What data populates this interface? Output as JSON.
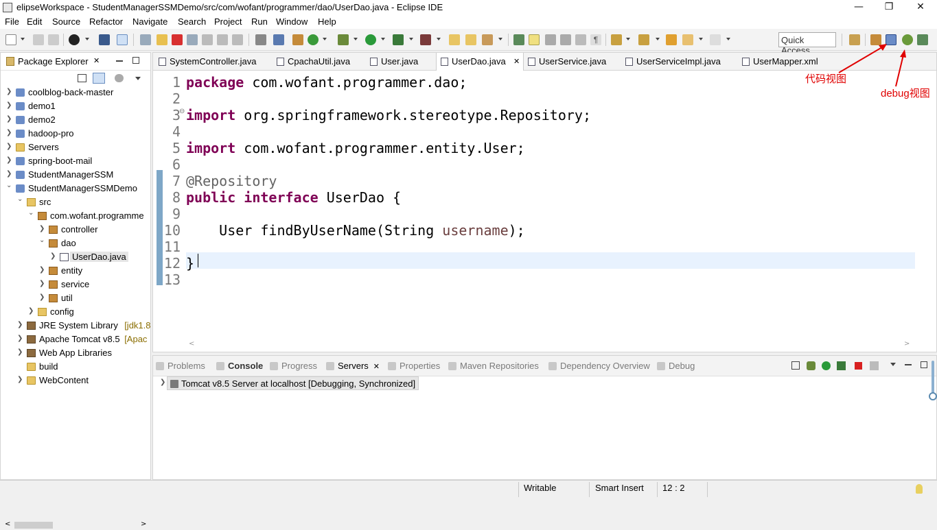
{
  "window": {
    "title": "elipseWorkspace - StudentManagerSSMDemo/src/com/wofant/programmer/dao/UserDao.java - Eclipse IDE",
    "minimize_glyph": "—",
    "maximize_glyph": "❐",
    "close_glyph": "✕"
  },
  "menu": [
    "File",
    "Edit",
    "Source",
    "Refactor",
    "Navigate",
    "Search",
    "Project",
    "Run",
    "Window",
    "Help"
  ],
  "toolbar": {
    "quick_access": "Quick Access"
  },
  "package_explorer": {
    "title": "Package Explorer",
    "close_glyph": "✕",
    "tree": [
      {
        "label": "coolblog-back-master",
        "level": 0,
        "expanded": false,
        "icon": "project-icon"
      },
      {
        "label": "demo1",
        "level": 0,
        "expanded": false,
        "icon": "project-icon"
      },
      {
        "label": "demo2",
        "level": 0,
        "expanded": false,
        "icon": "project-icon"
      },
      {
        "label": "hadoop-pro",
        "level": 0,
        "expanded": false,
        "icon": "project-icon"
      },
      {
        "label": "Servers",
        "level": 0,
        "expanded": false,
        "icon": "folder-icon"
      },
      {
        "label": "spring-boot-mail",
        "level": 0,
        "expanded": false,
        "icon": "project-icon"
      },
      {
        "label": "StudentManagerSSM",
        "level": 0,
        "expanded": false,
        "icon": "project-icon"
      },
      {
        "label": "StudentManagerSSMDemo",
        "level": 0,
        "expanded": true,
        "icon": "project-icon"
      },
      {
        "label": "src",
        "level": 1,
        "expanded": true,
        "icon": "source-folder-icon"
      },
      {
        "label": "com.wofant.programme",
        "level": 2,
        "expanded": true,
        "icon": "package-icon"
      },
      {
        "label": "controller",
        "level": 3,
        "expanded": false,
        "icon": "package-icon"
      },
      {
        "label": "dao",
        "level": 3,
        "expanded": true,
        "icon": "package-icon"
      },
      {
        "label": "UserDao.java",
        "level": 4,
        "expanded": false,
        "icon": "java-interface-icon",
        "selected": true
      },
      {
        "label": "entity",
        "level": 3,
        "expanded": false,
        "icon": "package-icon"
      },
      {
        "label": "service",
        "level": 3,
        "expanded": false,
        "icon": "package-icon"
      },
      {
        "label": "util",
        "level": 3,
        "expanded": false,
        "icon": "package-icon"
      },
      {
        "label": "config",
        "level": 2,
        "expanded": false,
        "icon": "source-folder-icon"
      },
      {
        "label": "JRE System Library",
        "decoration": " [jdk1.8.",
        "level": 1,
        "expanded": false,
        "icon": "library-icon"
      },
      {
        "label": "Apache Tomcat v8.5",
        "decoration": " [Apac",
        "level": 1,
        "expanded": false,
        "icon": "library-icon"
      },
      {
        "label": "Web App Libraries",
        "level": 1,
        "expanded": false,
        "icon": "library-icon"
      },
      {
        "label": "build",
        "level": 1,
        "expanded": null,
        "icon": "folder-icon"
      },
      {
        "label": "WebContent",
        "level": 1,
        "expanded": false,
        "icon": "folder-icon"
      }
    ]
  },
  "editor": {
    "tabs": [
      {
        "label": "SystemController.java",
        "active": false
      },
      {
        "label": "CpachaUtil.java",
        "active": false
      },
      {
        "label": "User.java",
        "active": false
      },
      {
        "label": "UserDao.java",
        "active": true
      },
      {
        "label": "UserService.java",
        "active": false
      },
      {
        "label": "UserServiceImpl.java",
        "active": false
      },
      {
        "label": "UserMapper.xml",
        "active": false
      }
    ],
    "close_glyph": "✕",
    "line_numbers": [
      "1",
      "2",
      "3",
      "4",
      "5",
      "6",
      "7",
      "8",
      "9",
      "10",
      "11",
      "12",
      "13"
    ],
    "fold_marker": "⊖",
    "lines": [
      {
        "kw": "package",
        "rest": " com.wofant.programmer.dao;"
      },
      {
        "kw": "",
        "rest": ""
      },
      {
        "kw": "import",
        "rest": " org.springframework.stereotype.Repository;"
      },
      {
        "kw": "",
        "rest": ""
      },
      {
        "kw": "import",
        "rest": " com.wofant.programmer.entity.User;"
      },
      {
        "kw": "",
        "rest": ""
      },
      {
        "annotation": "@Repository"
      },
      {
        "kw": "public",
        "kw2": "interface",
        "rest": " UserDao {"
      },
      {
        "kw": "",
        "rest": ""
      },
      {
        "indent": "    ",
        "rest": "User findByUserName(String ",
        "param": "username",
        "tail": ");"
      },
      {
        "kw": "",
        "rest": ""
      },
      {
        "kw": "",
        "rest": "}"
      },
      {
        "kw": "",
        "rest": ""
      }
    ]
  },
  "bottom_panel": {
    "tabs": [
      {
        "label": "Problems",
        "state": "inactive"
      },
      {
        "label": "Console",
        "state": "bold"
      },
      {
        "label": "Progress",
        "state": "inactive"
      },
      {
        "label": "Servers",
        "state": "active"
      },
      {
        "label": "Properties",
        "state": "inactive"
      },
      {
        "label": "Maven Repositories",
        "state": "inactive"
      },
      {
        "label": "Dependency Overview",
        "state": "inactive"
      },
      {
        "label": "Debug",
        "state": "inactive"
      }
    ],
    "close_glyph": "✕",
    "server": "Tomcat v8.5 Server at localhost  [Debugging, Synchronized]"
  },
  "status_bar": {
    "writable": "Writable",
    "insert_mode": "Smart Insert",
    "position": "12 : 2"
  },
  "annotations": {
    "code_view": "代码视图",
    "debug_view": "debug视图",
    "color": "#e00000"
  }
}
